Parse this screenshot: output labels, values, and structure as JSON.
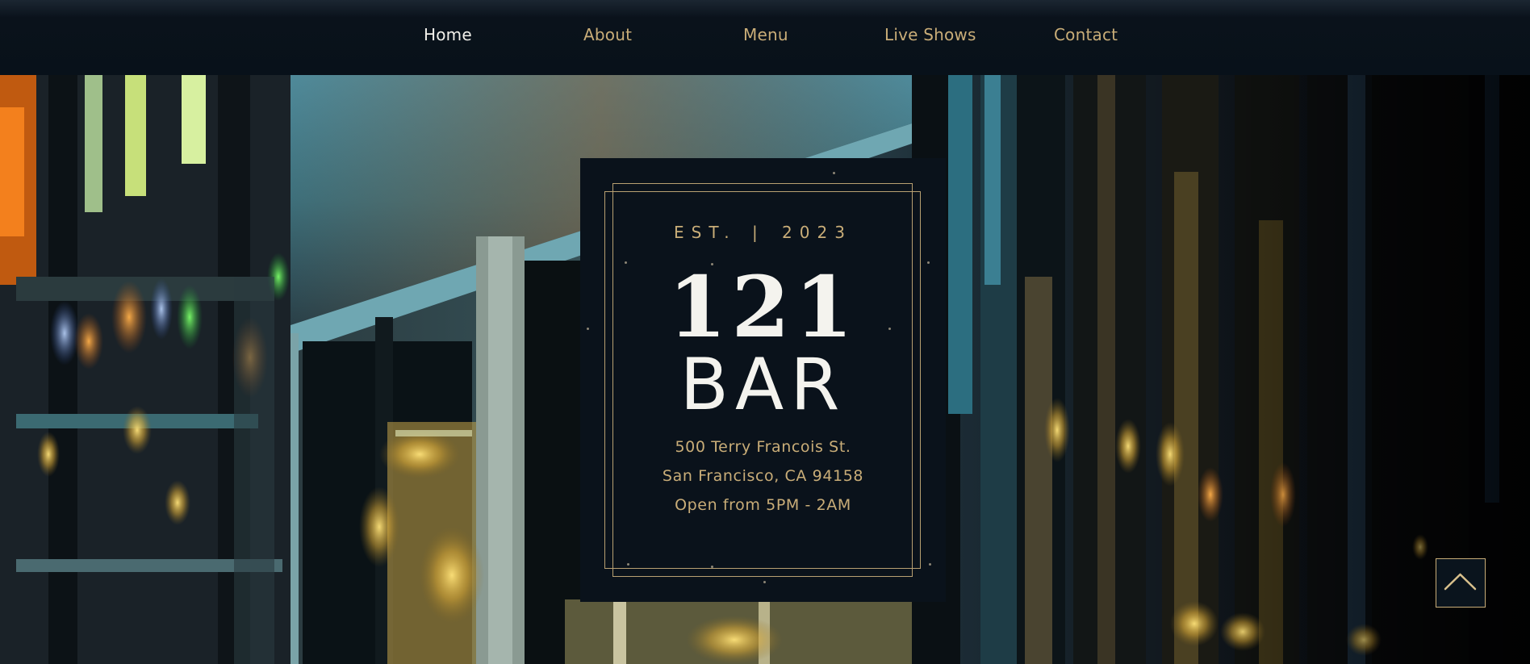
{
  "nav": {
    "items": [
      {
        "label": "Home",
        "active": true
      },
      {
        "label": "About",
        "active": false
      },
      {
        "label": "Menu",
        "active": false
      },
      {
        "label": "Live Shows",
        "active": false
      },
      {
        "label": "Contact",
        "active": false
      }
    ]
  },
  "sign": {
    "est_label": "EST.",
    "est_separator": "|",
    "est_year": "2023",
    "name_number": "121",
    "name_word": "BAR",
    "address_line_1": "500 Terry Francois St.",
    "address_line_2": "San Francisco, CA 94158",
    "hours": "Open from 5PM - 2AM"
  },
  "back_to_top": {
    "icon": "chevron-up-icon"
  },
  "colors": {
    "header_bg": "#08111a",
    "card_bg": "#0a121b",
    "gold_accent": "#c9ad78",
    "text_light": "#f4f3ee"
  }
}
